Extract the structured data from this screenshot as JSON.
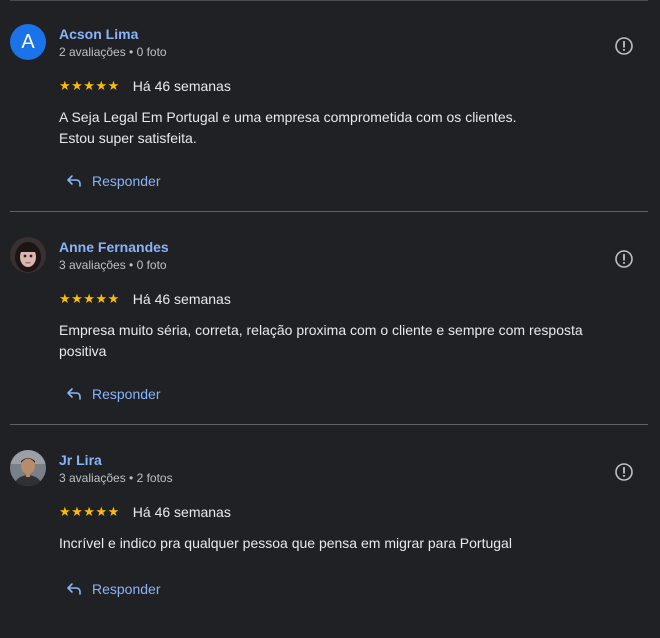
{
  "reviews": [
    {
      "name": "Acson Lima",
      "avatar_letter": "A",
      "meta": "2 avaliações • 0 foto",
      "stars": "★★★★★",
      "time": "Há 46 semanas",
      "text_lines": [
        "A Seja Legal Em Portugal e uma empresa comprometida com os clientes.",
        "Estou super satisfeita."
      ],
      "reply_label": "Responder"
    },
    {
      "name": "Anne Fernandes",
      "meta": "3 avaliações • 0 foto",
      "stars": "★★★★★",
      "time": "Há 46 semanas",
      "text_lines": [
        "Empresa muito séria, correta, relação proxima com o cliente e sempre com resposta",
        "positiva"
      ],
      "reply_label": "Responder"
    },
    {
      "name": "Jr Lira",
      "meta": "3 avaliações • 2 fotos",
      "stars": "★★★★★",
      "time": "Há 46 semanas",
      "text_lines": [
        "Incrível e indico pra qualquer pessoa que pensa em migrar para Portugal"
      ],
      "reply_label": "Responder"
    }
  ],
  "colors": {
    "background": "#202124",
    "link": "#8ab4f8",
    "star": "#fbbc04",
    "avatar_blue": "#1a73e8"
  }
}
